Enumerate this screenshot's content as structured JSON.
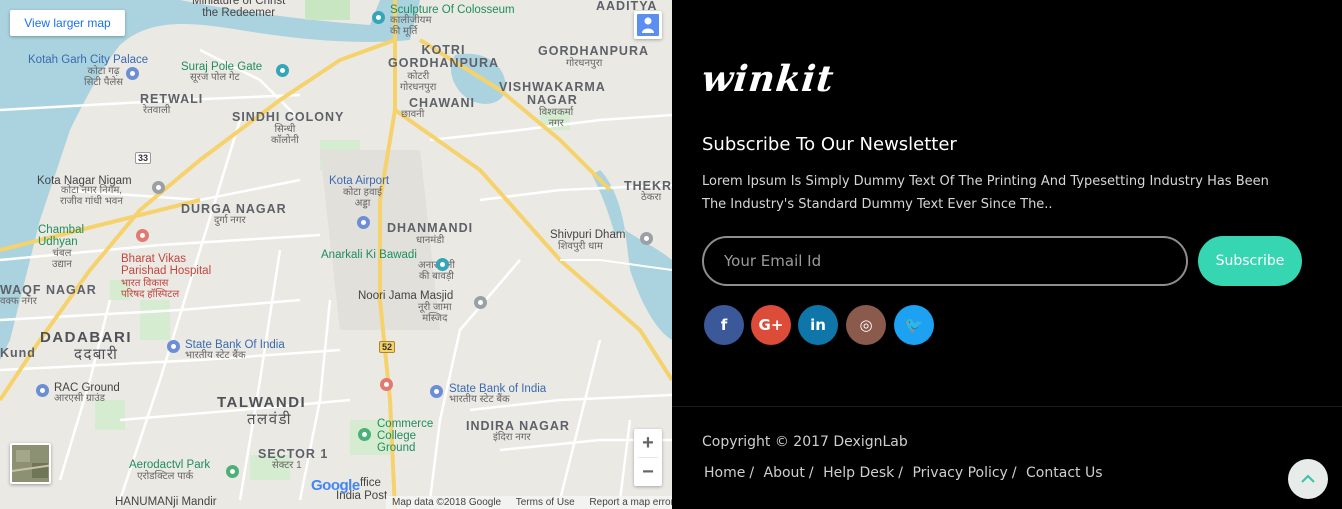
{
  "map": {
    "view_larger": "View larger map",
    "zoom_in": "+",
    "zoom_out": "−",
    "google": "Google",
    "footer": {
      "data": "Map data ©2018 Google",
      "terms": "Terms of Use",
      "report": "Report a map error"
    },
    "labels": {
      "redeemer": "Miniature of Christ\nthe Redeemer",
      "colosseum": "Sculpture Of Colosseum",
      "colosseum_hi": "कालीजीयम\nकी मूर्ति",
      "aaditya": "AADITYA",
      "kotri": "KOTRI\nGORDHANPURA",
      "kotri_hi": "कोटरी\nगोरधनपुरा",
      "gordhanpura": "GORDHANPURA",
      "gordhanpura_hi": "गोरधनपुरा",
      "garh": "Kotah Garh City Palace",
      "garh_hi": "कोटा गढ़\nसिटी पैलेस",
      "suraj": "Suraj Pole Gate",
      "suraj_hi": "सूरज पोल गेट",
      "retwali": "RETWALI",
      "retwali_hi": "रेतवाली",
      "chawani": "CHAWANI",
      "chawani_hi": "छावनी",
      "vishwakarma": "VISHWAKARMA\nNAGAR",
      "vishwakarma_hi": "विश्वकर्मा\nनगर",
      "sindhi": "SINDHI COLONY",
      "sindhi_hi": "सिन्धी\nकॉलोनी",
      "hw33": "33",
      "kotanagar": "Kota Nagar Nigam",
      "kotanagar_hi": "कोटा नगर निगम,\nराजीव गांधी भवन",
      "airport": "Kota Airport",
      "airport_hi": "कोटा हवाई\nअड्डा",
      "thekr": "THEKR",
      "thekr_hi": "ठेकरा",
      "durga": "DURGA NAGAR",
      "durga_hi": "दुर्गा नगर",
      "dhanmandi": "DHANMANDI",
      "dhanmandi_hi": "धानमंडी",
      "chambal": "Chambal\nUdhyan",
      "chambal_hi": "चंबल\nउद्यान",
      "bharat": "Bharat Vikas\nParishad Hospital",
      "bharat_hi": "भारत विकास\nपरिषद हॉस्पिटल",
      "anarkali": "Anarkali Ki Bawadi",
      "anarkali_hi": "अनारकली\nकी बावड़ी",
      "shivpuri": "Shivpuri Dham",
      "shivpuri_hi": "शिवपुरी धाम",
      "waqf": "WAQF NAGAR",
      "waqf_hi": "वक्फ नगर",
      "noori": "Noori Jama Masjid",
      "noori_hi": "नूरी जामा\nमस्जिद",
      "dadabari": "DADABARI",
      "dadabari_hi": "ददबारी",
      "kund": "Kund",
      "sbi1": "State Bank Of India",
      "sbi1_hi": "भारतीय स्टेट बैंक",
      "hw52": "52",
      "rac": "RAC Ground",
      "rac_hi": "आरएसी ग्राउंड",
      "sbi2": "State Bank of India",
      "sbi2_hi": "भारतीय स्टेट बैंक",
      "talwandi": "TALWANDI",
      "talwandi_hi": "तलवंडी",
      "indira": "INDIRA NAGAR",
      "indira_hi": "इंदिरा नगर",
      "commerce": "Commerce\nCollege\nGround",
      "sector1": "SECTOR 1",
      "sector1_hi": "सेक्टर 1",
      "aerodactvl": "Aerodactvl Park",
      "aerodactvl_hi": "एरोडक्टिल पार्क",
      "office": "ffice",
      "postoffice": "India Post",
      "hanuman": "HANUMANji Mandir"
    }
  },
  "panel": {
    "logo": "winkit",
    "newsletter_title": "Subscribe To Our Newsletter",
    "newsletter_text": "Lorem Ipsum Is Simply Dummy Text Of The Printing And Typesetting Industry Has Been The Industry's Standard Dummy Text Ever Since The..",
    "email_placeholder": "Your Email Id",
    "subscribe_label": "Subscribe",
    "social": [
      {
        "name": "facebook",
        "glyph": "f",
        "color": "#3b5998"
      },
      {
        "name": "google-plus",
        "glyph": "G+",
        "color": "#dd4b39"
      },
      {
        "name": "linkedin",
        "glyph": "in",
        "color": "#0e76a8"
      },
      {
        "name": "instagram",
        "glyph": "◎",
        "color": "#8a5a4c"
      },
      {
        "name": "twitter",
        "glyph": "🐦",
        "color": "#1da1f2"
      }
    ],
    "copyright": "Copyright © 2017 DexignLab",
    "links": [
      "Home",
      "About",
      "Help Desk",
      "Privacy Policy",
      "Contact Us"
    ],
    "to_top": "^"
  }
}
